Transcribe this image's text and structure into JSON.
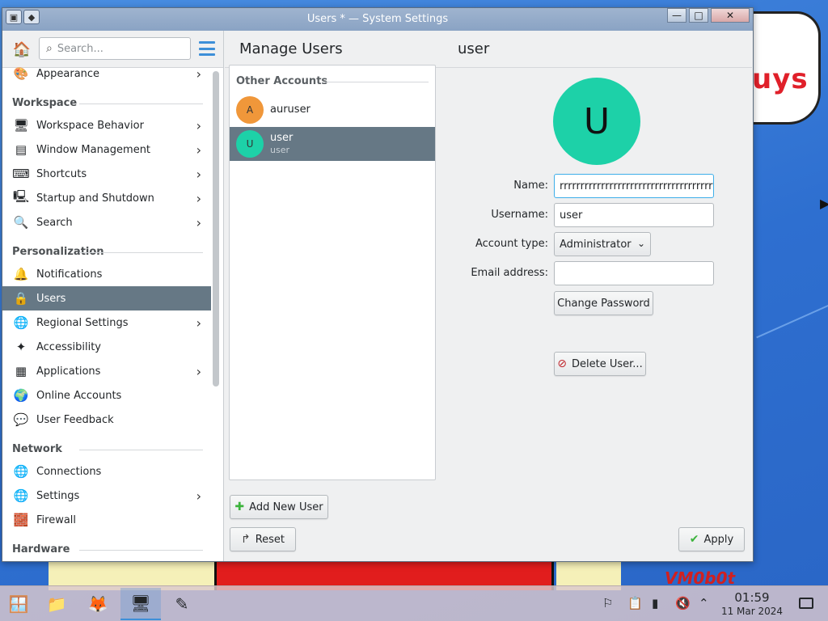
{
  "window": {
    "title": "Users * — System Settings",
    "controls": {
      "minimize": "—",
      "maximize": "□",
      "close": "✕"
    }
  },
  "sidebar": {
    "search_placeholder": "Search...",
    "items": [
      {
        "type": "item",
        "label": "Appearance",
        "icon": "appearance-icon",
        "glyph": "🎨",
        "chevron": true
      },
      {
        "type": "section",
        "label": "Workspace"
      },
      {
        "type": "item",
        "label": "Workspace Behavior",
        "icon": "workspace-behavior-icon",
        "glyph": "🖥",
        "chevron": true
      },
      {
        "type": "item",
        "label": "Window Management",
        "icon": "window-management-icon",
        "glyph": "▤",
        "chevron": true
      },
      {
        "type": "item",
        "label": "Shortcuts",
        "icon": "shortcuts-icon",
        "glyph": "⌨",
        "chevron": true
      },
      {
        "type": "item",
        "label": "Startup and Shutdown",
        "icon": "startup-shutdown-icon",
        "glyph": "🖳",
        "chevron": true
      },
      {
        "type": "item",
        "label": "Search",
        "icon": "search-settings-icon",
        "glyph": "🔍",
        "chevron": true
      },
      {
        "type": "section",
        "label": "Personalization"
      },
      {
        "type": "item",
        "label": "Notifications",
        "icon": "notifications-icon",
        "glyph": "🔔",
        "chevron": false
      },
      {
        "type": "item",
        "label": "Users",
        "icon": "users-icon",
        "glyph": "🔒",
        "chevron": false,
        "active": true
      },
      {
        "type": "item",
        "label": "Regional Settings",
        "icon": "regional-settings-icon",
        "glyph": "🌐",
        "chevron": true
      },
      {
        "type": "item",
        "label": "Accessibility",
        "icon": "accessibility-icon",
        "glyph": "✦",
        "chevron": false
      },
      {
        "type": "item",
        "label": "Applications",
        "icon": "applications-icon",
        "glyph": "▦",
        "chevron": true
      },
      {
        "type": "item",
        "label": "Online Accounts",
        "icon": "online-accounts-icon",
        "glyph": "🌍",
        "chevron": false
      },
      {
        "type": "item",
        "label": "User Feedback",
        "icon": "user-feedback-icon",
        "glyph": "💬",
        "chevron": false
      },
      {
        "type": "section",
        "label": "Network"
      },
      {
        "type": "item",
        "label": "Connections",
        "icon": "connections-icon",
        "glyph": "🌐",
        "chevron": false
      },
      {
        "type": "item",
        "label": "Settings",
        "icon": "network-settings-icon",
        "glyph": "🌐",
        "chevron": true
      },
      {
        "type": "item",
        "label": "Firewall",
        "icon": "firewall-icon",
        "glyph": "🧱",
        "chevron": false
      },
      {
        "type": "section",
        "label": "Hardware"
      }
    ]
  },
  "main": {
    "heading": "Manage Users",
    "subheading": "user",
    "other_accounts_label": "Other Accounts",
    "accounts": [
      {
        "initial": "A",
        "name": "auruser",
        "sub": "",
        "color": "#f0973a",
        "selected": false
      },
      {
        "initial": "U",
        "name": "user",
        "sub": "user",
        "color": "#1dd1a8",
        "selected": true
      }
    ],
    "add_user": "Add New User",
    "reset": "Reset",
    "apply": "Apply"
  },
  "details": {
    "avatar_initial": "U",
    "avatar_color": "#1dd1a8",
    "name_label": "Name:",
    "name_value": "rrrrrrrrrrrrrrrrrrrrrrrrrrrrrrrrrrrrrrrrr",
    "username_label": "Username:",
    "username_value": "user",
    "account_type_label": "Account type:",
    "account_type_value": "Administrator",
    "email_label": "Email address:",
    "email_value": "",
    "change_password": "Change Password",
    "delete_user": "Delete User..."
  },
  "wallpaper": {
    "text_top": "uys",
    "text_bottom": "VM0b0t"
  },
  "taskbar": {
    "clock_time": "01:59",
    "clock_date": "11 Mar 2024"
  }
}
